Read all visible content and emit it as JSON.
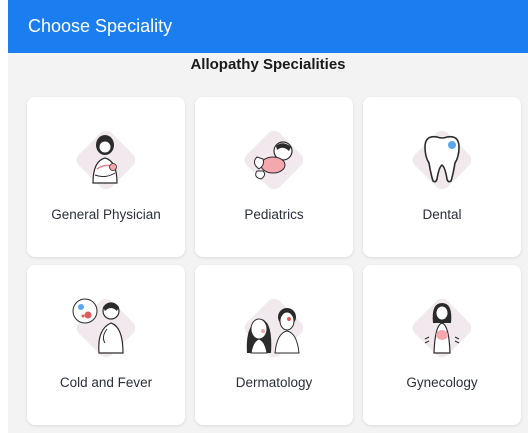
{
  "header": {
    "title": "Choose Speciality"
  },
  "section": {
    "title": "Allopathy Specialities"
  },
  "specialities": [
    {
      "label": "General Physician",
      "icon": "general-physician-icon"
    },
    {
      "label": "Pediatrics",
      "icon": "pediatrics-icon"
    },
    {
      "label": "Dental",
      "icon": "tooth-icon"
    },
    {
      "label": "Cold and Fever",
      "icon": "cold-fever-icon"
    },
    {
      "label": "Dermatology",
      "icon": "dermatology-icon"
    },
    {
      "label": "Gynecology",
      "icon": "gynecology-icon"
    }
  ],
  "colors": {
    "header_bg": "#1b7ef0",
    "content_bg": "#f3f3f3",
    "illustration_bg": "#f1e9ee",
    "accent_pink": "#f4a7ad",
    "accent_blue": "#5aa7f0"
  }
}
